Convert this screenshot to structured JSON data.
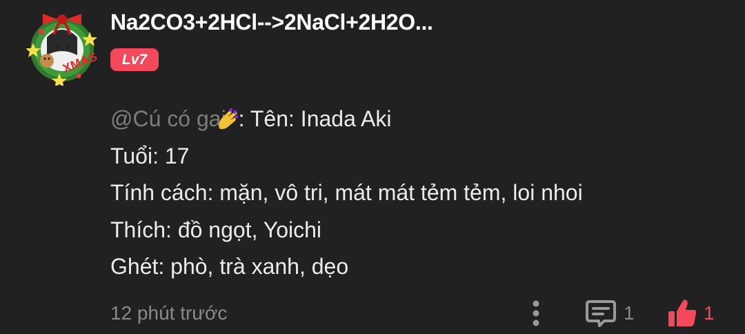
{
  "comment": {
    "author": {
      "name": "Na2CO3+2HCl-->2NaCl+2H2O...",
      "level": "Lv7",
      "avatar_icon": "christmas-wreath-avatar-icon",
      "avatar_text": "XMAS"
    },
    "mention": "@Cú có gai",
    "mention_emoji": "nail-polish-hand-emoji",
    "lines": [
      ": Tên: Inada Aki",
      "Tuổi: 17",
      "Tính cách: mặn, vô tri, mát mát tẻm tẻm, loi nhoi",
      "Thích: đồ ngọt, Yoichi",
      "Ghét: phò, trà xanh, dẹo"
    ],
    "timestamp": "12 phút trước",
    "reply_count": "1",
    "like_count": "1"
  },
  "icons": {
    "more": "more-vertical-icon",
    "reply": "comment-icon",
    "like": "thumbs-up-icon"
  },
  "colors": {
    "background": "#212121",
    "accent": "#f3495a",
    "text": "#ececec",
    "muted": "#8a8a8a",
    "mention": "#7d7d7d"
  }
}
